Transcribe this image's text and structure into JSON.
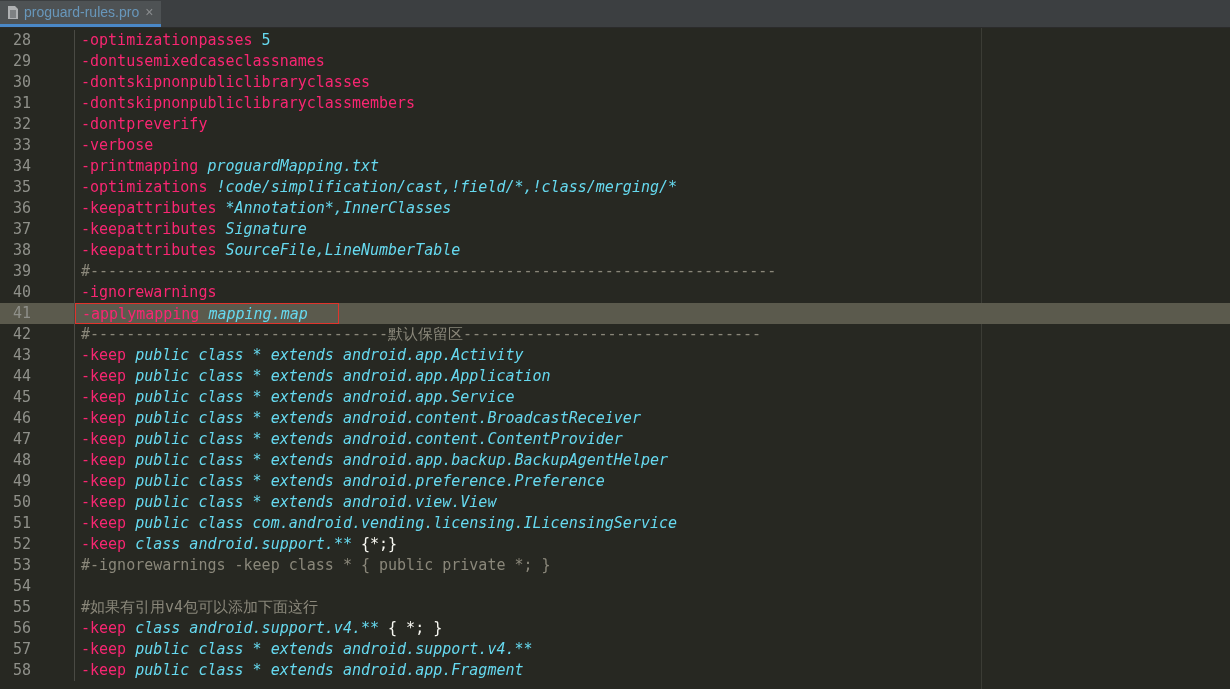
{
  "tabs": [
    {
      "label": "proguard-rules.pro",
      "selected": true,
      "close": "×"
    }
  ],
  "lines": [
    {
      "number": "28",
      "current": false,
      "marked": false,
      "tokens": [
        {
          "kind": "flag",
          "text": "-optimizationpasses"
        },
        {
          "kind": "plain",
          "text": " 5"
        }
      ]
    },
    {
      "number": "29",
      "current": false,
      "marked": false,
      "tokens": [
        {
          "kind": "flag",
          "text": "-dontusemixedcaseclassnames"
        }
      ]
    },
    {
      "number": "30",
      "current": false,
      "marked": false,
      "tokens": [
        {
          "kind": "flag",
          "text": "-dontskipnonpubliclibraryclasses"
        }
      ]
    },
    {
      "number": "31",
      "current": false,
      "marked": false,
      "tokens": [
        {
          "kind": "flag",
          "text": "-dontskipnonpubliclibraryclassmembers"
        }
      ]
    },
    {
      "number": "32",
      "current": false,
      "marked": false,
      "tokens": [
        {
          "kind": "flag",
          "text": "-dontpreverify"
        }
      ]
    },
    {
      "number": "33",
      "current": false,
      "marked": false,
      "tokens": [
        {
          "kind": "flag",
          "text": "-verbose"
        }
      ]
    },
    {
      "number": "34",
      "current": false,
      "marked": false,
      "tokens": [
        {
          "kind": "flag",
          "text": "-printmapping"
        },
        {
          "kind": "arg",
          "text": " proguardMapping.txt"
        }
      ]
    },
    {
      "number": "35",
      "current": false,
      "marked": false,
      "tokens": [
        {
          "kind": "flag",
          "text": "-optimizations"
        },
        {
          "kind": "arg",
          "text": " !code/simplification/cast,!field/*,!class/merging/*"
        }
      ]
    },
    {
      "number": "36",
      "current": false,
      "marked": false,
      "tokens": [
        {
          "kind": "flag",
          "text": "-keepattributes"
        },
        {
          "kind": "arg",
          "text": " *Annotation*,InnerClasses"
        }
      ]
    },
    {
      "number": "37",
      "current": false,
      "marked": false,
      "tokens": [
        {
          "kind": "flag",
          "text": "-keepattributes"
        },
        {
          "kind": "arg",
          "text": " Signature"
        }
      ]
    },
    {
      "number": "38",
      "current": false,
      "marked": false,
      "tokens": [
        {
          "kind": "flag",
          "text": "-keepattributes"
        },
        {
          "kind": "arg",
          "text": " SourceFile,LineNumberTable"
        }
      ]
    },
    {
      "number": "39",
      "current": false,
      "marked": false,
      "tokens": [
        {
          "kind": "comment",
          "text": "#----------------------------------------------------------------------------"
        }
      ]
    },
    {
      "number": "40",
      "current": false,
      "marked": false,
      "tokens": [
        {
          "kind": "flag",
          "text": "-ignorewarnings"
        }
      ]
    },
    {
      "number": "41",
      "current": true,
      "marked": true,
      "tokens": [
        {
          "kind": "flag",
          "text": "-applymapping"
        },
        {
          "kind": "arg",
          "text": " mapping.map"
        }
      ]
    },
    {
      "number": "42",
      "current": false,
      "marked": false,
      "tokens": [
        {
          "kind": "comment",
          "text": "#---------------------------------默认保留区---------------------------------"
        }
      ]
    },
    {
      "number": "43",
      "current": false,
      "marked": false,
      "tokens": [
        {
          "kind": "flag",
          "text": "-keep"
        },
        {
          "kind": "arg",
          "text": " public class * extends android.app.Activity"
        }
      ]
    },
    {
      "number": "44",
      "current": false,
      "marked": false,
      "tokens": [
        {
          "kind": "flag",
          "text": "-keep"
        },
        {
          "kind": "arg",
          "text": " public class * extends android.app.Application"
        }
      ]
    },
    {
      "number": "45",
      "current": false,
      "marked": false,
      "tokens": [
        {
          "kind": "flag",
          "text": "-keep"
        },
        {
          "kind": "arg",
          "text": " public class * extends android.app.Service"
        }
      ]
    },
    {
      "number": "46",
      "current": false,
      "marked": false,
      "tokens": [
        {
          "kind": "flag",
          "text": "-keep"
        },
        {
          "kind": "arg",
          "text": " public class * extends android.content.BroadcastReceiver"
        }
      ]
    },
    {
      "number": "47",
      "current": false,
      "marked": false,
      "tokens": [
        {
          "kind": "flag",
          "text": "-keep"
        },
        {
          "kind": "arg",
          "text": " public class * extends android.content.ContentProvider"
        }
      ]
    },
    {
      "number": "48",
      "current": false,
      "marked": false,
      "tokens": [
        {
          "kind": "flag",
          "text": "-keep"
        },
        {
          "kind": "arg",
          "text": " public class * extends android.app.backup.BackupAgentHelper"
        }
      ]
    },
    {
      "number": "49",
      "current": false,
      "marked": false,
      "tokens": [
        {
          "kind": "flag",
          "text": "-keep"
        },
        {
          "kind": "arg",
          "text": " public class * extends android.preference.Preference"
        }
      ]
    },
    {
      "number": "50",
      "current": false,
      "marked": false,
      "tokens": [
        {
          "kind": "flag",
          "text": "-keep"
        },
        {
          "kind": "arg",
          "text": " public class * extends android.view.View"
        }
      ]
    },
    {
      "number": "51",
      "current": false,
      "marked": false,
      "tokens": [
        {
          "kind": "flag",
          "text": "-keep"
        },
        {
          "kind": "arg",
          "text": " public class com.android.vending.licensing.ILicensingService"
        }
      ]
    },
    {
      "number": "52",
      "current": false,
      "marked": false,
      "tokens": [
        {
          "kind": "flag",
          "text": "-keep"
        },
        {
          "kind": "arg",
          "text": " class android.support."
        },
        {
          "kind": "plain",
          "text": "**"
        },
        {
          "kind": "punct",
          "text": " {*;}"
        }
      ]
    },
    {
      "number": "53",
      "current": false,
      "marked": false,
      "tokens": [
        {
          "kind": "comment",
          "text": "#-ignorewarnings -keep class * { public private *; }"
        }
      ]
    },
    {
      "number": "54",
      "current": false,
      "marked": false
    },
    {
      "number": "55",
      "current": false,
      "marked": false,
      "tokens": [
        {
          "kind": "comment",
          "text": "#如果有引用v4包可以添加下面这行"
        }
      ]
    },
    {
      "number": "56",
      "current": false,
      "marked": false,
      "tokens": [
        {
          "kind": "flag",
          "text": "-keep"
        },
        {
          "kind": "arg",
          "text": " class android.support.v4."
        },
        {
          "kind": "plain",
          "text": "**"
        },
        {
          "kind": "punct",
          "text": " { *; }"
        }
      ]
    },
    {
      "number": "57",
      "current": false,
      "marked": false,
      "tokens": [
        {
          "kind": "flag",
          "text": "-keep"
        },
        {
          "kind": "arg",
          "text": " public class * extends android.support.v4."
        },
        {
          "kind": "plain",
          "text": "**"
        }
      ]
    },
    {
      "number": "58",
      "current": false,
      "marked": false,
      "tokens": [
        {
          "kind": "flag",
          "text": "-keep"
        },
        {
          "kind": "arg",
          "text": " public class * extends android.app.Fragment"
        }
      ]
    }
  ]
}
